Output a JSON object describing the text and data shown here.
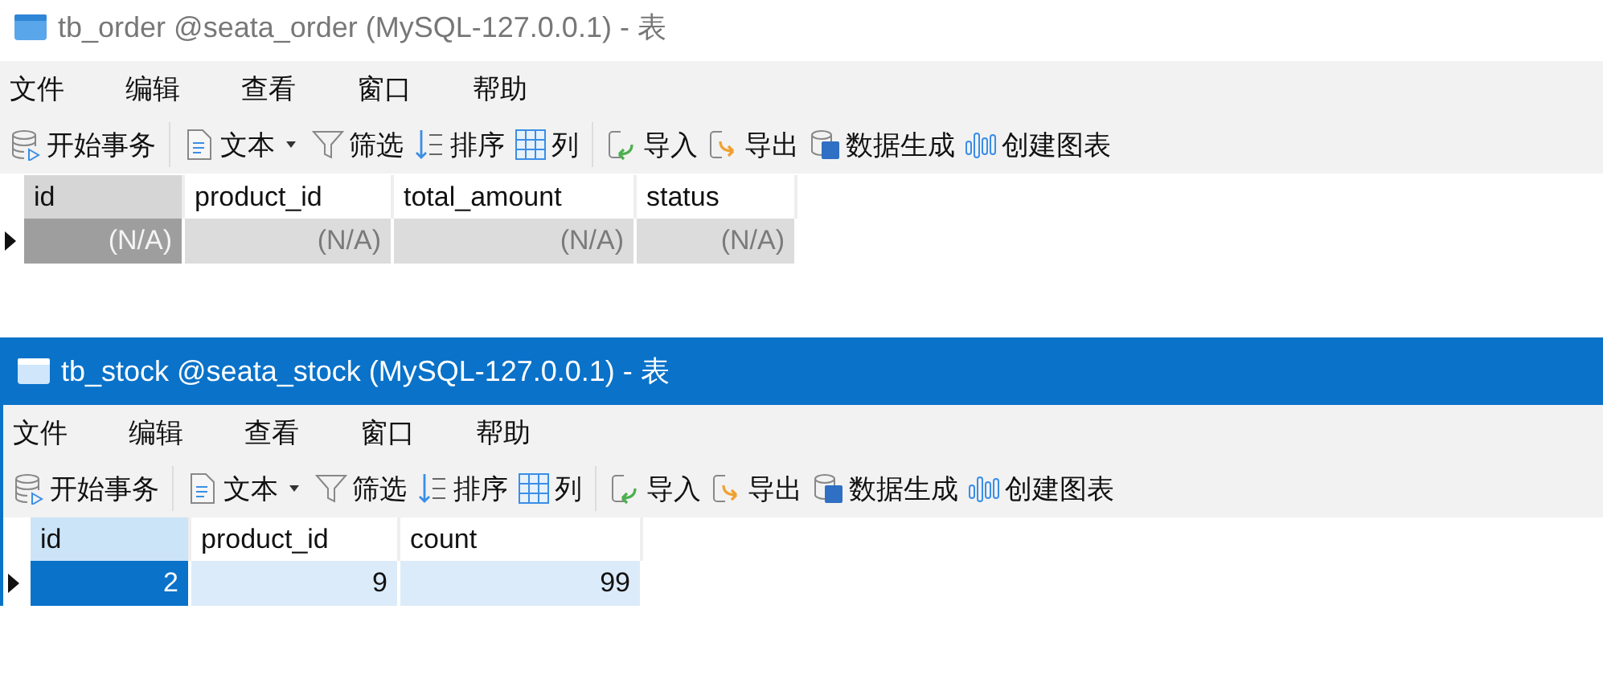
{
  "windows": [
    {
      "title": "tb_order @seata_order (MySQL-127.0.0.1) - 表",
      "active": false,
      "menu": [
        "文件",
        "编辑",
        "查看",
        "窗口",
        "帮助"
      ],
      "toolbar": [
        [
          {
            "label": "开始事务",
            "dropdown": false
          }
        ],
        [
          {
            "label": "文本",
            "dropdown": true
          },
          {
            "label": "筛选",
            "dropdown": false
          },
          {
            "label": "排序",
            "dropdown": false
          },
          {
            "label": "列",
            "dropdown": false
          }
        ],
        [
          {
            "label": "导入",
            "dropdown": false
          },
          {
            "label": "导出",
            "dropdown": false
          },
          {
            "label": "数据生成",
            "dropdown": false
          },
          {
            "label": "创建图表",
            "dropdown": false
          }
        ]
      ],
      "table": {
        "columns": [
          {
            "label": "id",
            "selected": true
          },
          {
            "label": "product_id",
            "selected": false
          },
          {
            "label": "total_amount",
            "selected": false
          },
          {
            "label": "status",
            "selected": false
          }
        ],
        "rows": [
          {
            "current": true,
            "cells": [
              {
                "text": "(N/A)",
                "kind": "null",
                "selected": true
              },
              {
                "text": "(N/A)",
                "kind": "null",
                "selected": false
              },
              {
                "text": "(N/A)",
                "kind": "null",
                "selected": false
              },
              {
                "text": "(N/A)",
                "kind": "null",
                "selected": false
              }
            ]
          }
        ]
      }
    },
    {
      "title": "tb_stock @seata_stock (MySQL-127.0.0.1) - 表",
      "active": true,
      "menu": [
        "文件",
        "编辑",
        "查看",
        "窗口",
        "帮助"
      ],
      "toolbar": [
        [
          {
            "label": "开始事务",
            "dropdown": false
          }
        ],
        [
          {
            "label": "文本",
            "dropdown": true
          },
          {
            "label": "筛选",
            "dropdown": false
          },
          {
            "label": "排序",
            "dropdown": false
          },
          {
            "label": "列",
            "dropdown": false
          }
        ],
        [
          {
            "label": "导入",
            "dropdown": false
          },
          {
            "label": "导出",
            "dropdown": false
          },
          {
            "label": "数据生成",
            "dropdown": false
          },
          {
            "label": "创建图表",
            "dropdown": false
          }
        ]
      ],
      "table": {
        "columns": [
          {
            "label": "id",
            "selected": true
          },
          {
            "label": "product_id",
            "selected": false
          },
          {
            "label": "count",
            "selected": false
          }
        ],
        "rows": [
          {
            "current": true,
            "cells": [
              {
                "text": "2",
                "kind": "number",
                "selected": true
              },
              {
                "text": "9",
                "kind": "number",
                "selected": false
              },
              {
                "text": "99",
                "kind": "number",
                "selected": false
              }
            ]
          }
        ]
      }
    }
  ]
}
